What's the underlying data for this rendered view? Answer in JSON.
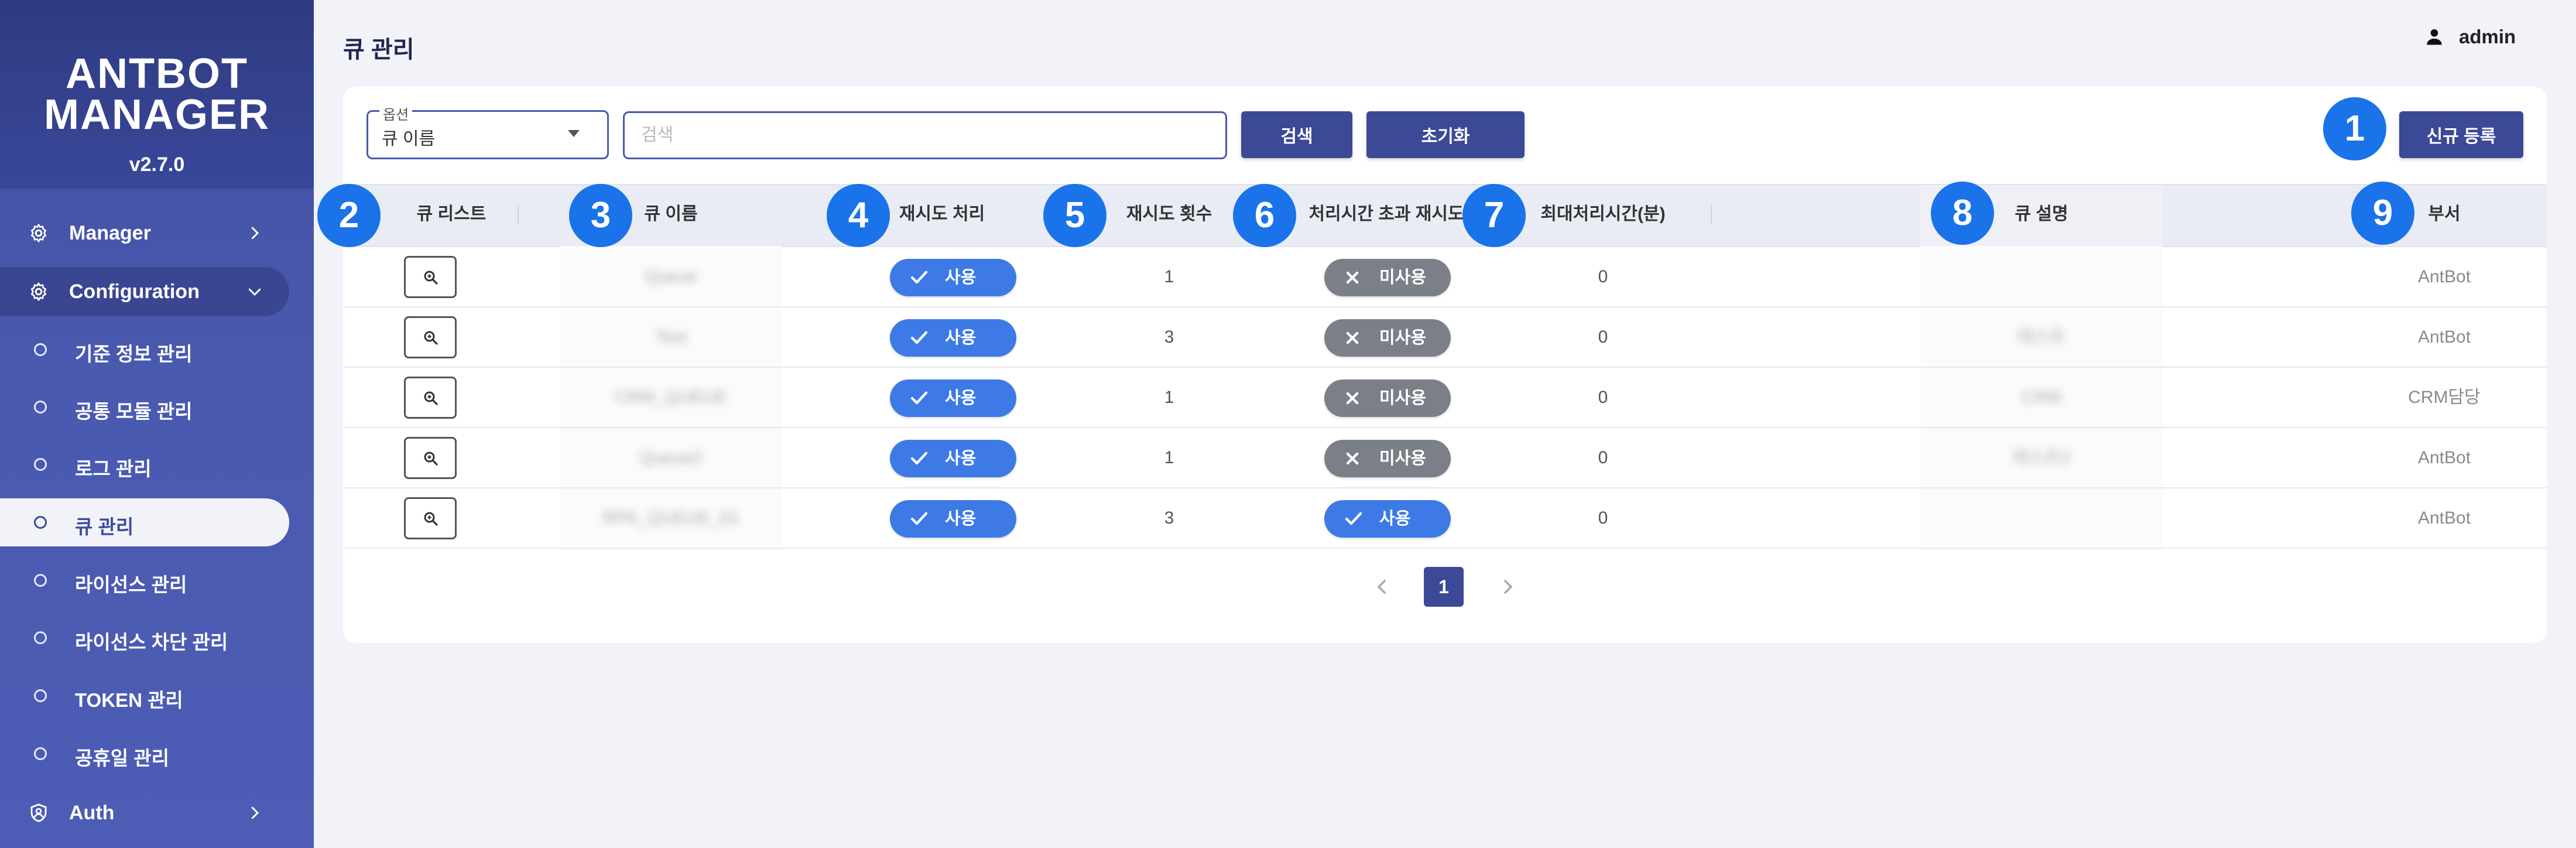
{
  "app": {
    "brand_line1": "ANTBOT",
    "brand_line2": "MANAGER",
    "version": "v2.7.0"
  },
  "sidebar": {
    "items": [
      {
        "label": "Manager",
        "icon": "gear-icon"
      },
      {
        "label": "Configuration",
        "icon": "gear-icon"
      },
      {
        "label": "Auth",
        "icon": "shield-user-icon"
      }
    ],
    "sub_items": [
      {
        "label": "기준 정보 관리"
      },
      {
        "label": "공통 모듈 관리"
      },
      {
        "label": "로그 관리"
      },
      {
        "label": "큐 관리"
      },
      {
        "label": "라이선스 관리"
      },
      {
        "label": "라이선스 차단 관리"
      },
      {
        "label": "TOKEN 관리"
      },
      {
        "label": "공휴일 관리"
      }
    ]
  },
  "header": {
    "title": "큐 관리",
    "user": "admin"
  },
  "toolbar": {
    "option_legend": "옵션",
    "option_value": "큐 이름",
    "search_placeholder": "검색",
    "search_label": "검색",
    "reset_label": "초기화",
    "new_label": "신규 등록"
  },
  "table": {
    "columns": [
      "큐 리스트",
      "큐 이름",
      "재시도 처리",
      "재시도 횟수",
      "처리시간 초과 재시도",
      "최대처리시간(분)",
      "큐 설명",
      "부서"
    ],
    "rows": [
      {
        "name": "Queue",
        "retry": "사용",
        "retry_count": "1",
        "timeout_retry": "미사용",
        "max_time": "0",
        "desc": "",
        "dept": "AntBot"
      },
      {
        "name": "Test",
        "retry": "사용",
        "retry_count": "3",
        "timeout_retry": "미사용",
        "max_time": "0",
        "desc": "테스트",
        "dept": "AntBot"
      },
      {
        "name": "CRM_QUEUE",
        "retry": "사용",
        "retry_count": "1",
        "timeout_retry": "미사용",
        "max_time": "0",
        "desc": "CRM",
        "dept": "CRM담당"
      },
      {
        "name": "Queue2",
        "retry": "사용",
        "retry_count": "1",
        "timeout_retry": "미사용",
        "max_time": "0",
        "desc": "테스트2",
        "dept": "AntBot"
      },
      {
        "name": "RPA_QUEUE_01",
        "retry": "사용",
        "retry_count": "3",
        "timeout_retry": "사용",
        "max_time": "0",
        "desc": "",
        "dept": "AntBot"
      }
    ]
  },
  "pagination": {
    "current": "1"
  },
  "markers": [
    "1",
    "2",
    "3",
    "4",
    "5",
    "6",
    "7",
    "8",
    "9"
  ],
  "colors": {
    "sidebar": "#4a5ab0",
    "primary_button": "#3b4996",
    "chip_on": "#3d7ae6",
    "chip_off": "#7b8088",
    "marker": "#1a73e8"
  }
}
